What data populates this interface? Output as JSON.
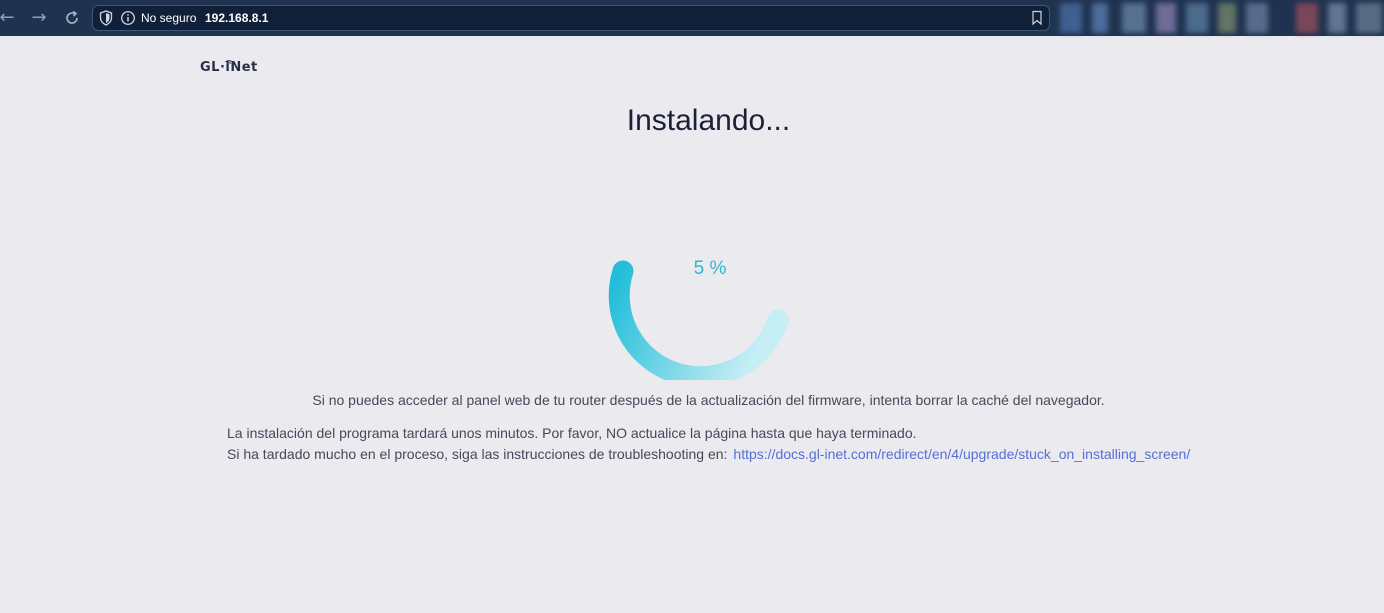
{
  "browser": {
    "back_icon": "arrow-left-icon",
    "forward_icon": "arrow-right-icon",
    "reload_icon": "reload-icon",
    "security_label": "No seguro",
    "url": "192.168.8.1",
    "bookmark_icon": "bookmark-icon"
  },
  "page": {
    "logo_text": "GL·iNet",
    "title": "Instalando...",
    "progress": {
      "percent_label": "5 %",
      "value": 0.05,
      "colors": {
        "start": "#22bdd9",
        "end": "#c6eef5"
      }
    },
    "hint": "Si no puedes acceder al panel web de tu router después de la actualización del firmware, intenta borrar la caché del navegador.",
    "info_line1": "La instalación del programa tardará unos minutos. Por favor, NO actualice la página hasta que haya terminado.",
    "info_line2": "Si ha tardado mucho en el proceso, siga las instrucciones de troubleshooting en:",
    "troubleshooting_link": "https://docs.gl-inet.com/redirect/en/4/upgrade/stuck_on_installing_screen/"
  },
  "colors": {
    "background": "#ebeaef",
    "browser_bar": "#1f3350",
    "link": "#5470d8"
  }
}
